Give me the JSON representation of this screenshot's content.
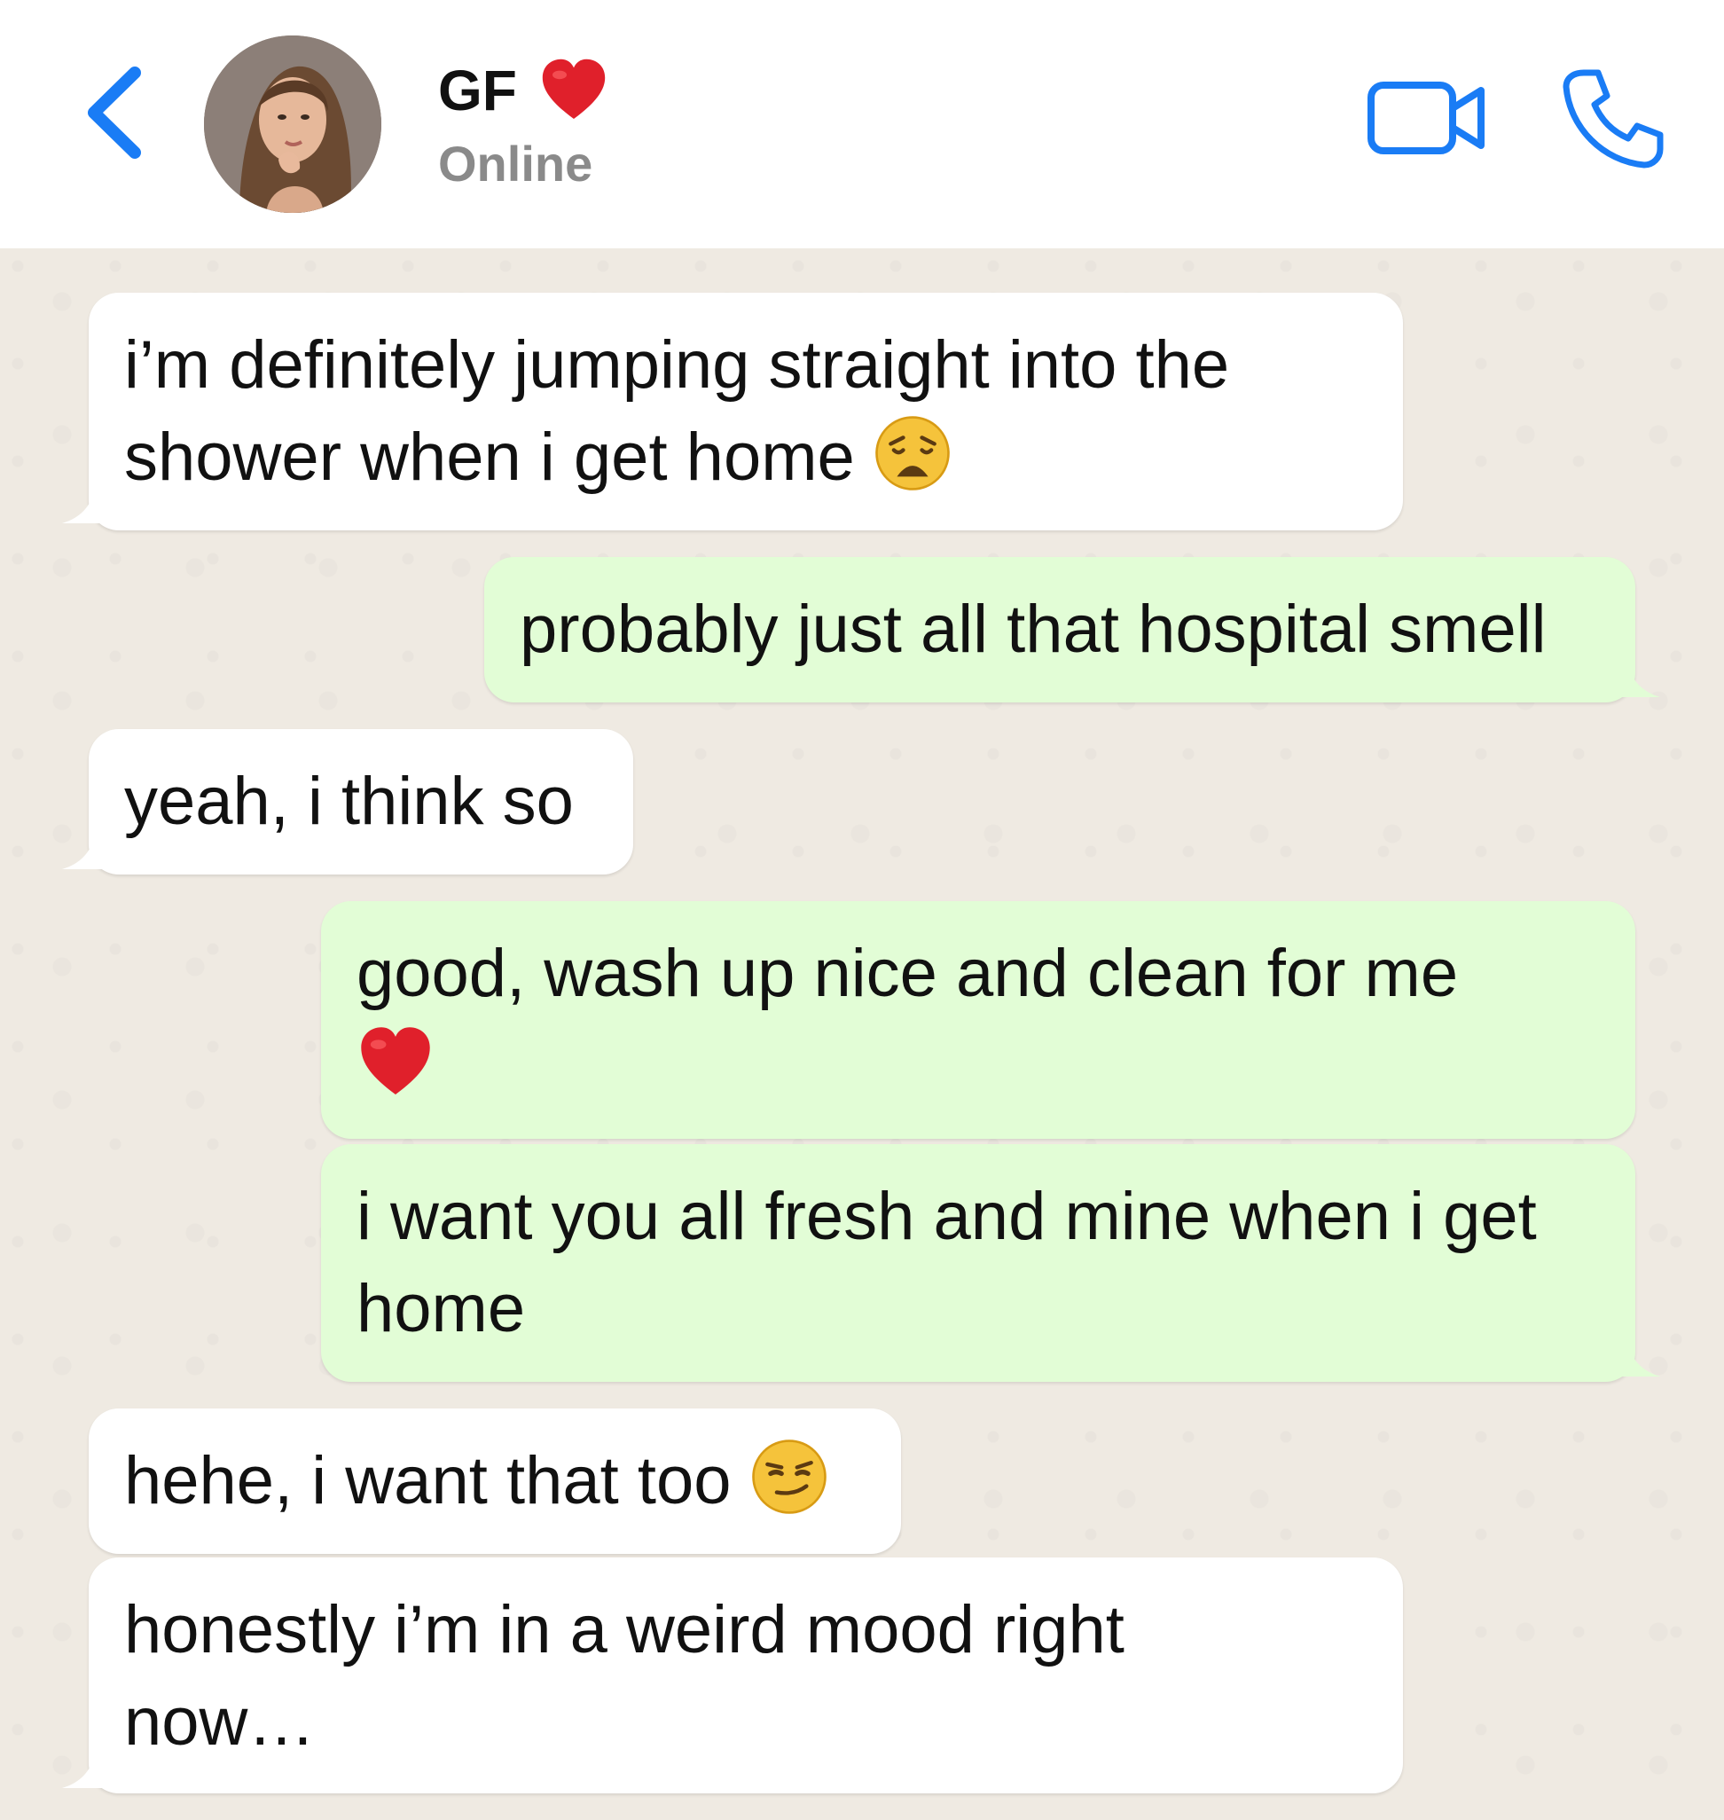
{
  "header": {
    "contact_name": "GF",
    "status": "Online",
    "back_icon": "chevron-left-icon",
    "video_icon": "video-camera-icon",
    "phone_icon": "phone-icon",
    "accent_color": "#1a7cf5"
  },
  "messages": [
    {
      "direction": "incoming",
      "lines": [
        "i’m definitely jumping straight into the",
        "shower when i get home"
      ],
      "emoji": "weary-face-emoji"
    },
    {
      "direction": "outgoing",
      "lines": [
        "probably just all that hospital smell"
      ]
    },
    {
      "direction": "incoming",
      "lines": [
        "yeah, i think so"
      ]
    },
    {
      "direction": "outgoing",
      "lines": [
        "good, wash up nice and clean for me"
      ],
      "emoji": "red-heart-emoji"
    },
    {
      "direction": "outgoing",
      "lines": [
        "i want you all fresh and mine when i get",
        "home"
      ]
    },
    {
      "direction": "incoming",
      "lines": [
        "hehe, i want that too"
      ],
      "emoji": "smirking-face-emoji"
    },
    {
      "direction": "incoming",
      "lines": [
        "honestly i’m in a weird mood right",
        "now…"
      ]
    }
  ],
  "colors": {
    "incoming_bubble": "#ffffff",
    "outgoing_bubble": "#e2fdd6",
    "chat_background": "#efeae2"
  }
}
